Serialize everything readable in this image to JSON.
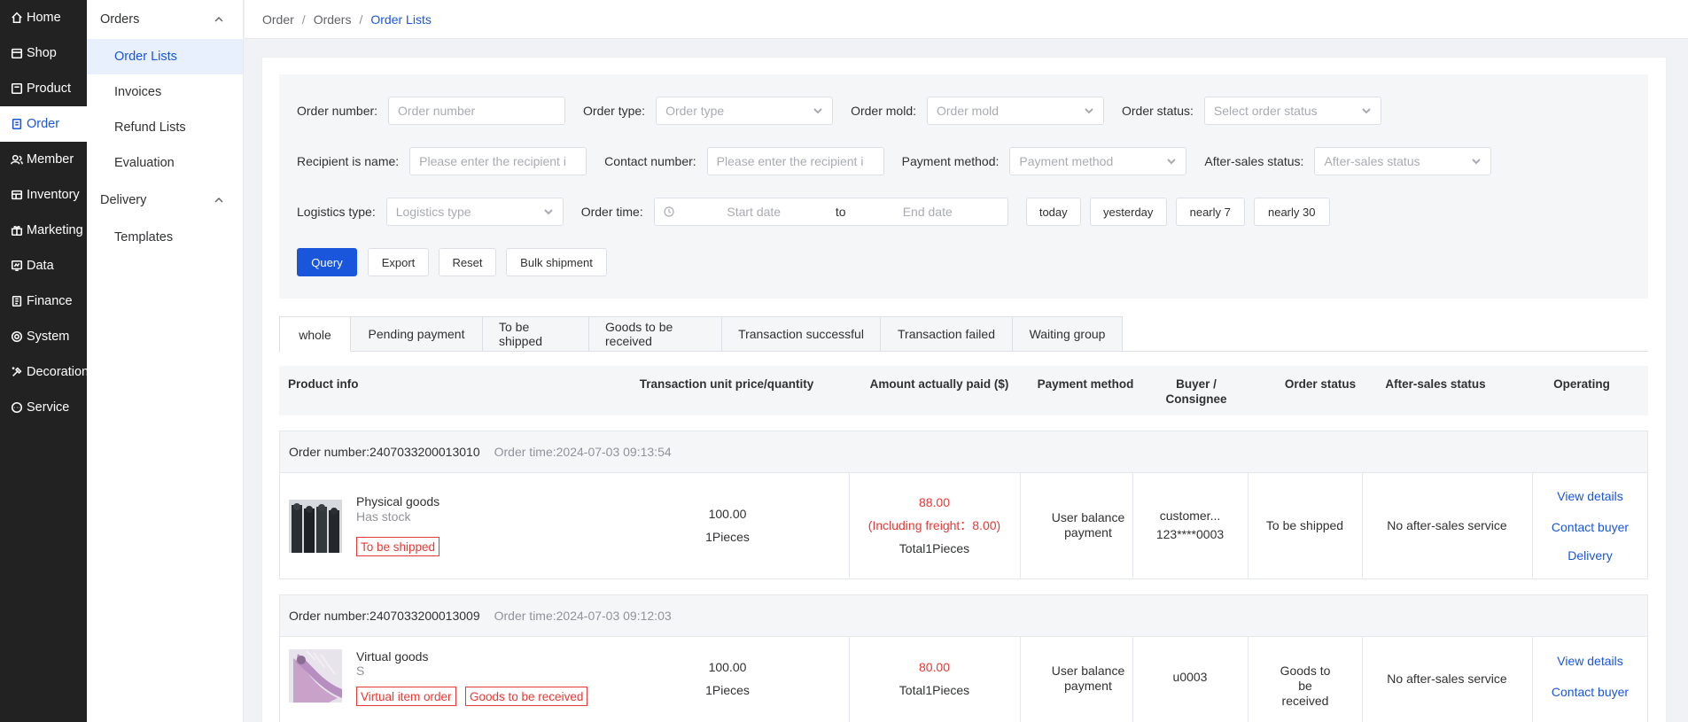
{
  "nav": {
    "items": [
      {
        "label": "Home",
        "icon": "home-icon"
      },
      {
        "label": "Shop",
        "icon": "shop-icon"
      },
      {
        "label": "Product",
        "icon": "product-icon"
      },
      {
        "label": "Order",
        "icon": "order-icon"
      },
      {
        "label": "Member",
        "icon": "member-icon"
      },
      {
        "label": "Inventory",
        "icon": "inventory-icon"
      },
      {
        "label": "Marketing",
        "icon": "marketing-icon"
      },
      {
        "label": "Data",
        "icon": "data-icon"
      },
      {
        "label": "Finance",
        "icon": "finance-icon"
      },
      {
        "label": "System",
        "icon": "system-icon"
      },
      {
        "label": "Decoration",
        "icon": "decoration-icon"
      },
      {
        "label": "Service",
        "icon": "service-icon"
      }
    ]
  },
  "subnav": {
    "group1": "Orders",
    "items1": [
      "Order Lists",
      "Invoices",
      "Refund Lists",
      "Evaluation"
    ],
    "group2": "Delivery",
    "items2": [
      "Templates"
    ]
  },
  "breadcrumb": [
    "Order",
    "Orders",
    "Order Lists"
  ],
  "filters": {
    "order_number_label": "Order number:",
    "order_number_placeholder": "Order number",
    "order_type_label": "Order type:",
    "order_type_placeholder": "Order type",
    "order_mold_label": "Order mold:",
    "order_mold_placeholder": "Order mold",
    "order_status_label": "Order status:",
    "order_status_placeholder": "Select order status",
    "recipient_label": "Recipient is name:",
    "recipient_placeholder": "Please enter the recipient i",
    "contact_label": "Contact number:",
    "contact_placeholder": "Please enter the recipient i",
    "payment_label": "Payment method:",
    "payment_placeholder": "Payment method",
    "aftersales_label": "After-sales status:",
    "aftersales_placeholder": "After-sales status",
    "logistics_label": "Logistics type:",
    "logistics_placeholder": "Logistics type",
    "order_time_label": "Order time:",
    "start_date": "Start date",
    "to": "to",
    "end_date": "End date",
    "quick": [
      "today",
      "yesterday",
      "nearly 7",
      "nearly 30"
    ],
    "actions": [
      "Query",
      "Export",
      "Reset",
      "Bulk shipment"
    ]
  },
  "tabs": [
    "whole",
    "Pending payment",
    "To be shipped",
    "Goods to be received",
    "Transaction successful",
    "Transaction failed",
    "Waiting group"
  ],
  "table": {
    "headers": {
      "product": "Product info",
      "price": "Transaction unit price/quantity",
      "amount": "Amount actually paid ($)",
      "payment": "Payment method",
      "buyer": "Buyer / Consignee",
      "status": "Order status",
      "aftersales": "After-sales status",
      "operating": "Operating"
    }
  },
  "orders": [
    {
      "number": "Order number:2407033200013010",
      "time": "Order time:2024-07-03 09:13:54",
      "product_name": "Physical goods",
      "spec": "Has stock",
      "tags": [
        "To be shipped"
      ],
      "unit_price": "100.00",
      "quantity": "1Pieces",
      "paid": "88.00",
      "freight": "(Including freight：8.00)",
      "total": "Total1Pieces",
      "payment": "User balance payment",
      "buyer_line1": "customer...",
      "buyer_line2": "123****0003",
      "status": "To be shipped",
      "aftersales": "No after-sales service",
      "operations": [
        "View details",
        "Contact buyer",
        "Delivery"
      ]
    },
    {
      "number": "Order number:2407033200013009",
      "time": "Order time:2024-07-03 09:12:03",
      "product_name": "Virtual goods",
      "spec": "S",
      "tags": [
        "Virtual item order",
        "Goods to be received"
      ],
      "unit_price": "100.00",
      "quantity": "1Pieces",
      "paid": "80.00",
      "total": "Total1Pieces",
      "payment": "User balance payment",
      "buyer_line1": "u0003",
      "status": "Goods to be received",
      "aftersales": "No after-sales service",
      "operations": [
        "View details",
        "Contact buyer"
      ]
    }
  ]
}
